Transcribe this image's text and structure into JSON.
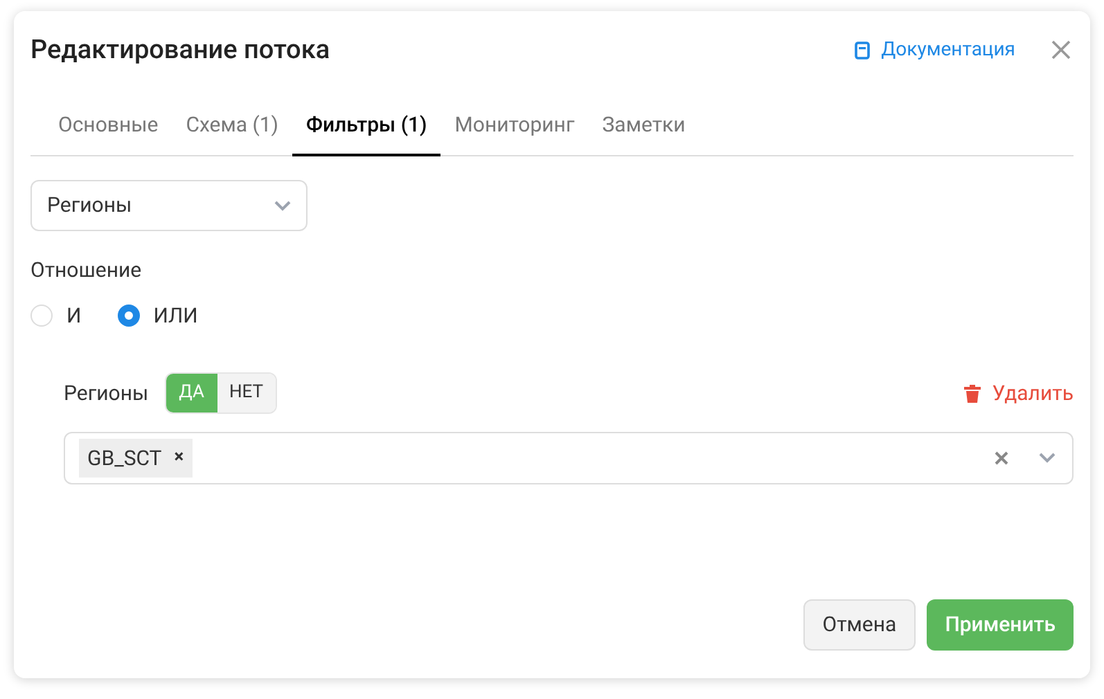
{
  "dialog": {
    "title": "Редактирование потока",
    "doc_link": "Документация"
  },
  "tabs": [
    {
      "label": "Основные",
      "selected": false
    },
    {
      "label": "Схема (1)",
      "selected": false
    },
    {
      "label": "Фильтры (1)",
      "selected": true
    },
    {
      "label": "Мониторинг",
      "selected": false
    },
    {
      "label": "Заметки",
      "selected": false
    }
  ],
  "filter_type": {
    "value": "Регионы"
  },
  "relation": {
    "label": "Отношение",
    "options": [
      {
        "label": "И",
        "selected": false
      },
      {
        "label": "ИЛИ",
        "selected": true
      }
    ]
  },
  "filter": {
    "label": "Регионы",
    "toggle": [
      {
        "label": "ДА",
        "selected": true
      },
      {
        "label": "НЕТ",
        "selected": false
      }
    ],
    "delete": "Удалить",
    "tags": [
      {
        "label": "GB_SCT",
        "remove": "×"
      }
    ]
  },
  "buttons": {
    "cancel": "Отмена",
    "apply": "Применить"
  }
}
